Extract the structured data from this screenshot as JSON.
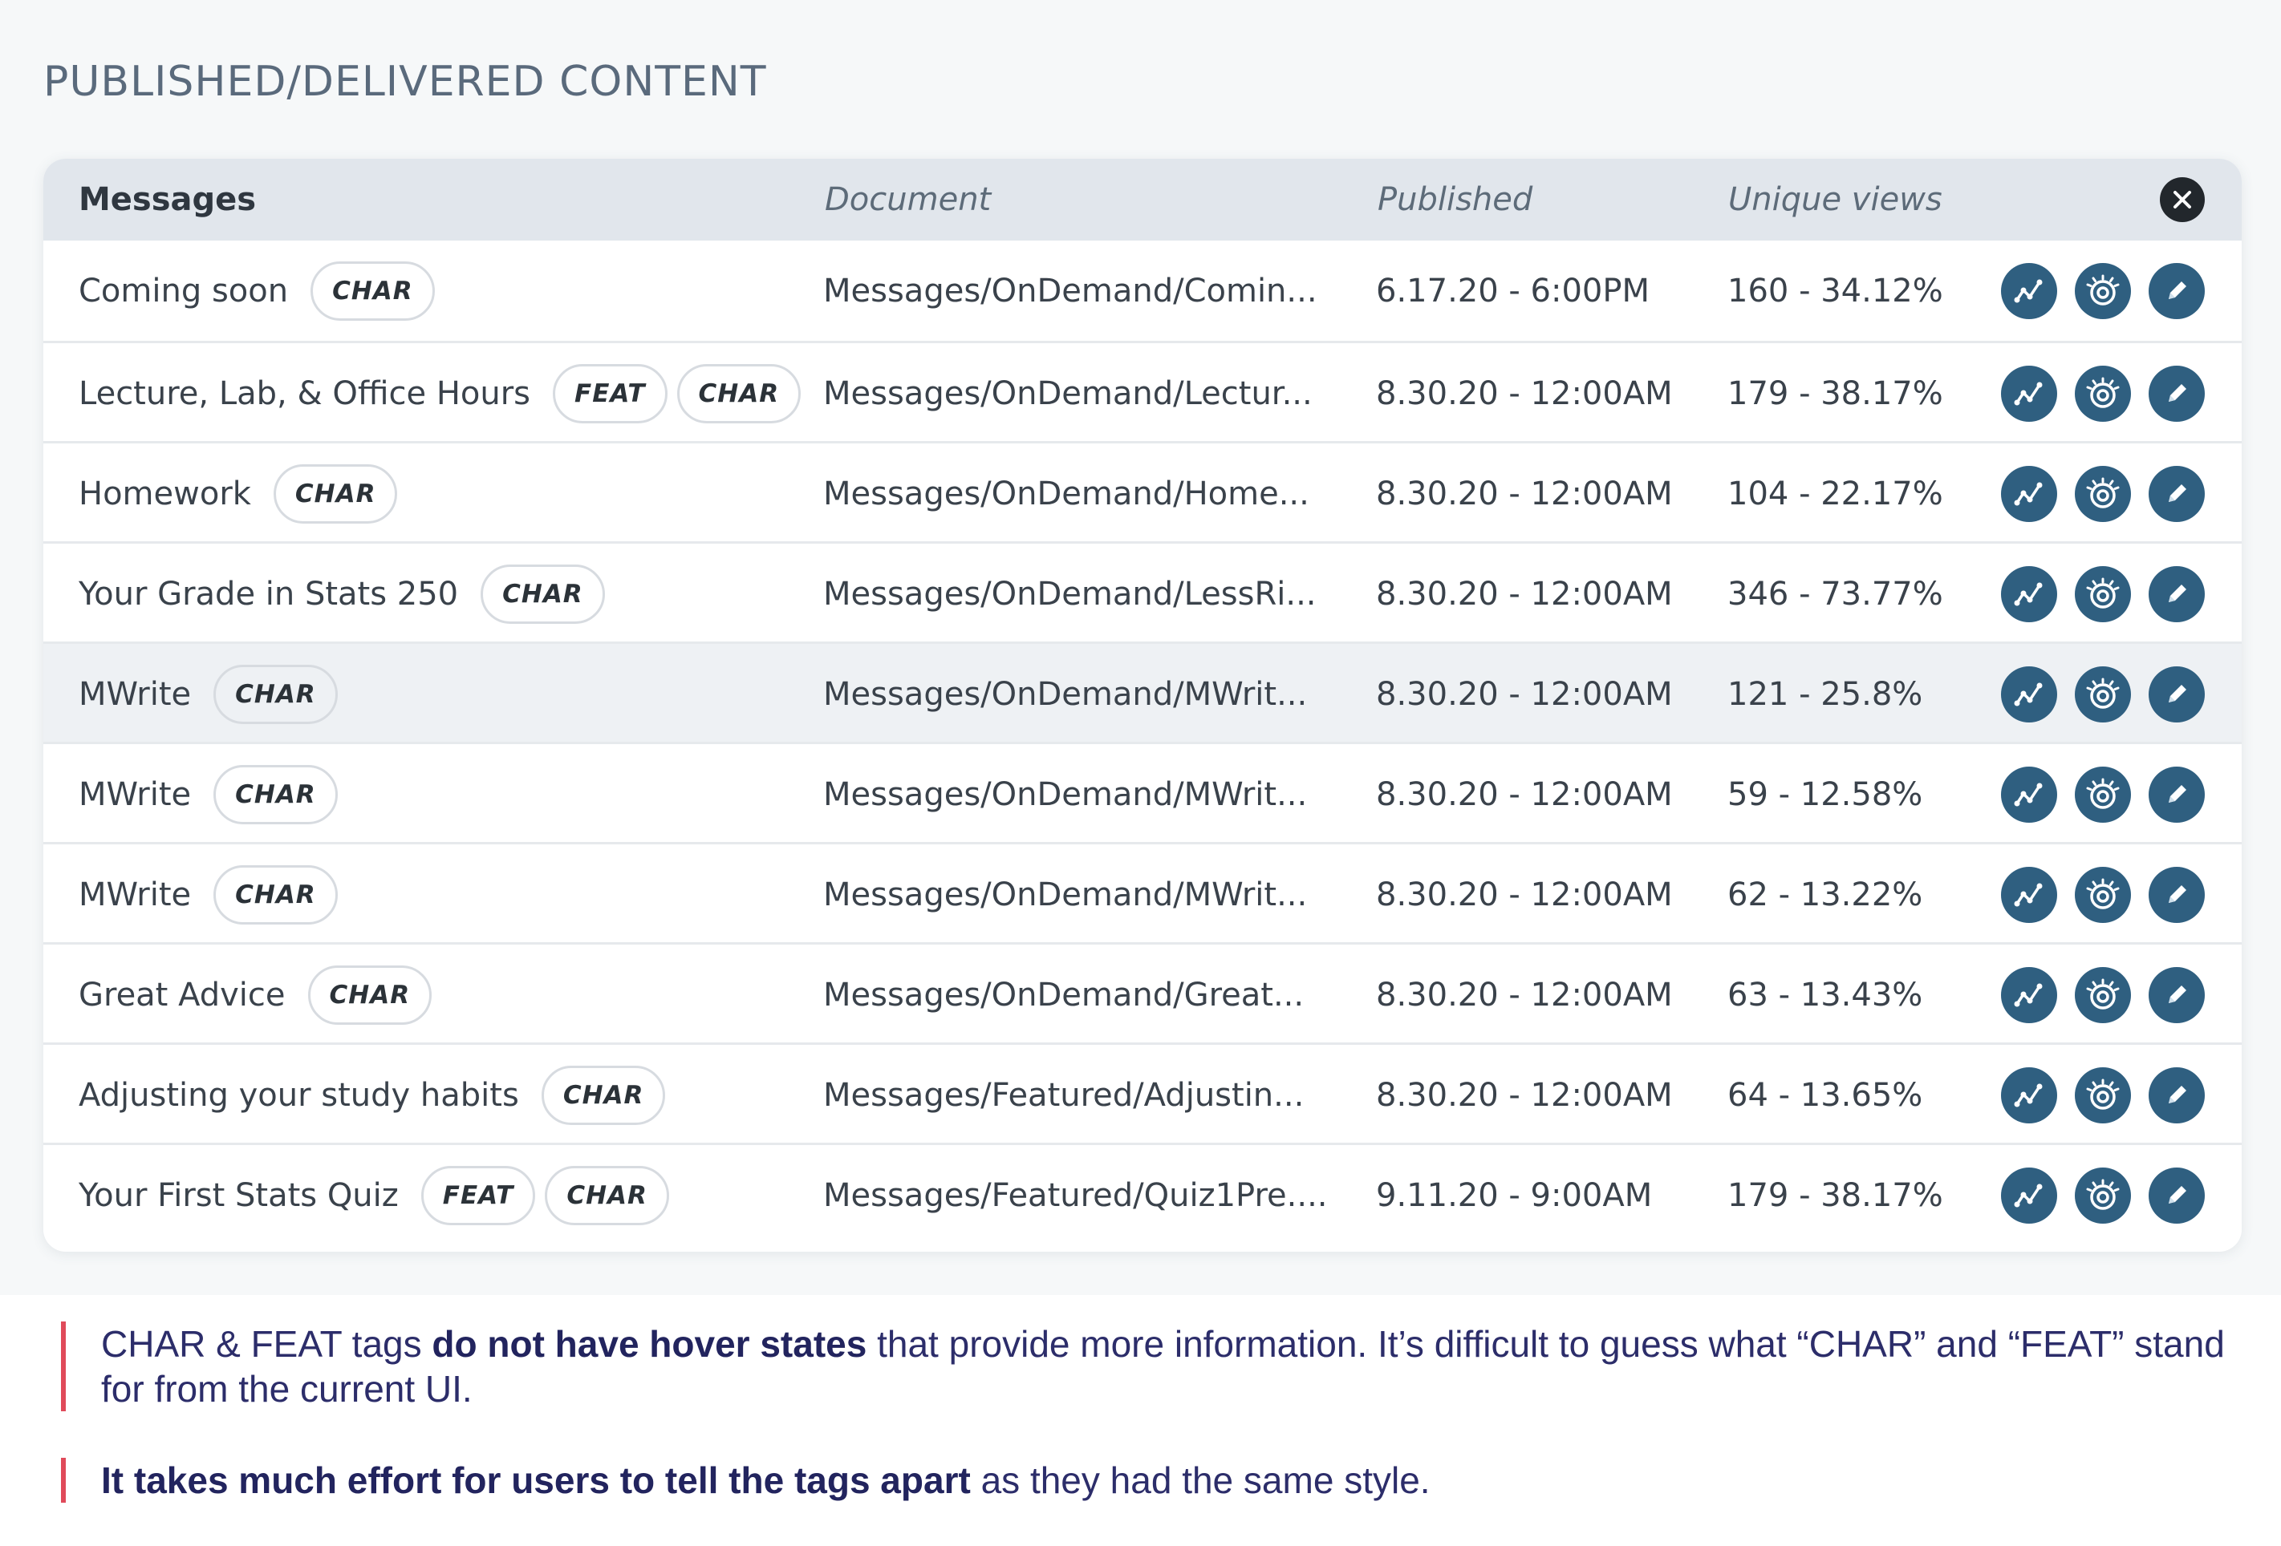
{
  "section_title": "PUBLISHED/DELIVERED CONTENT",
  "table": {
    "headers": {
      "messages": "Messages",
      "document": "Document",
      "published": "Published",
      "unique_views": "Unique views"
    },
    "rows": [
      {
        "title": "Coming soon",
        "tags": [
          "CHAR"
        ],
        "document": "Messages/OnDemand/Comin...",
        "published": "6.17.20 - 6:00PM",
        "views": "160 - 34.12%"
      },
      {
        "title": "Lecture, Lab, & Office Hours",
        "tags": [
          "FEAT",
          "CHAR"
        ],
        "document": "Messages/OnDemand/Lectur...",
        "published": "8.30.20 - 12:00AM",
        "views": "179 - 38.17%"
      },
      {
        "title": "Homework",
        "tags": [
          "CHAR"
        ],
        "document": "Messages/OnDemand/Home...",
        "published": "8.30.20 - 12:00AM",
        "views": "104 - 22.17%"
      },
      {
        "title": "Your Grade in Stats 250",
        "tags": [
          "CHAR"
        ],
        "document": "Messages/OnDemand/LessRi...",
        "published": "8.30.20 - 12:00AM",
        "views": "346 - 73.77%"
      },
      {
        "title": "MWrite",
        "tags": [
          "CHAR"
        ],
        "document": "Messages/OnDemand/MWrit...",
        "published": "8.30.20 - 12:00AM",
        "views": "121 - 25.8%",
        "highlighted": true
      },
      {
        "title": "MWrite",
        "tags": [
          "CHAR"
        ],
        "document": "Messages/OnDemand/MWrit...",
        "published": "8.30.20 - 12:00AM",
        "views": "59 - 12.58%"
      },
      {
        "title": "MWrite",
        "tags": [
          "CHAR"
        ],
        "document": "Messages/OnDemand/MWrit...",
        "published": "8.30.20 - 12:00AM",
        "views": "62 - 13.22%"
      },
      {
        "title": "Great Advice",
        "tags": [
          "CHAR"
        ],
        "document": "Messages/OnDemand/Great...",
        "published": "8.30.20 - 12:00AM",
        "views": "63 - 13.43%"
      },
      {
        "title": "Adjusting your study habits",
        "tags": [
          "CHAR"
        ],
        "document": "Messages/Featured/Adjustin...",
        "published": "8.30.20 - 12:00AM",
        "views": "64 - 13.65%"
      },
      {
        "title": "Your First Stats Quiz",
        "tags": [
          "FEAT",
          "CHAR"
        ],
        "document": "Messages/Featured/Quiz1Pre....",
        "published": "9.11.20 - 9:00AM",
        "views": "179 - 38.17%"
      }
    ],
    "action_icons": [
      "analytics-icon",
      "preview-icon",
      "edit-icon"
    ],
    "close_icon": "close-icon"
  },
  "notes": [
    {
      "parts": [
        {
          "text": "CHAR & FEAT tags ",
          "bold": false
        },
        {
          "text": "do not have hover states",
          "bold": true
        },
        {
          "text": " that provide more information. It’s difficult to guess what “CHAR” and “FEAT” stand for from the current UI.",
          "bold": false
        }
      ]
    },
    {
      "parts": [
        {
          "text": "It takes much effort for users to tell the tags apart",
          "bold": true
        },
        {
          "text": " as they had the same style.",
          "bold": false
        }
      ]
    }
  ],
  "colors": {
    "accent_icon": "#2f5f80",
    "note_bar": "#e04a5a",
    "note_text": "#2c2d6a",
    "header_bg": "#e1e6ec",
    "highlight_row": "#eef1f4"
  }
}
